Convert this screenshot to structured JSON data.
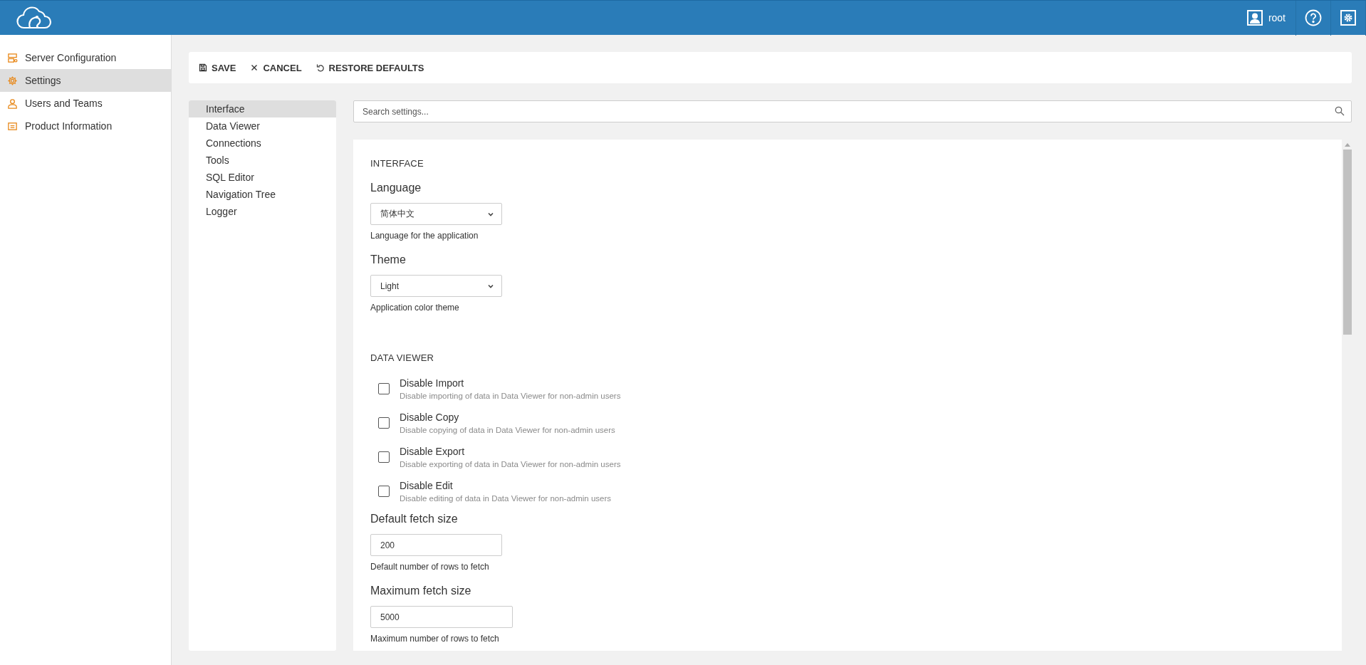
{
  "header": {
    "user": "root"
  },
  "sidebar": {
    "items": [
      {
        "label": "Server Configuration",
        "selected": false
      },
      {
        "label": "Settings",
        "selected": true
      },
      {
        "label": "Users and Teams",
        "selected": false
      },
      {
        "label": "Product Information",
        "selected": false
      }
    ]
  },
  "toolbar": {
    "buttons": [
      "SAVE",
      "CANCEL",
      "RESTORE DEFAULTS"
    ]
  },
  "settings_nav": {
    "items": [
      {
        "label": "Interface",
        "selected": true
      },
      {
        "label": "Data Viewer",
        "selected": false
      },
      {
        "label": "Connections",
        "selected": false
      },
      {
        "label": "Tools",
        "selected": false
      },
      {
        "label": "SQL Editor",
        "selected": false
      },
      {
        "label": "Navigation Tree",
        "selected": false
      },
      {
        "label": "Logger",
        "selected": false
      }
    ]
  },
  "search": {
    "placeholder": "Search settings..."
  },
  "sections": [
    {
      "title": "INTERFACE",
      "items": [
        {
          "kind": "select",
          "label": "Language",
          "value": "简体中文",
          "help": "Language for the application"
        },
        {
          "kind": "select",
          "label": "Theme",
          "value": "Light",
          "help": "Application color theme"
        }
      ]
    },
    {
      "title": "DATA VIEWER",
      "items": [
        {
          "kind": "checkbox",
          "label": "Disable Import",
          "description": "Disable importing of data in Data Viewer for non-admin users",
          "checked": false
        },
        {
          "kind": "checkbox",
          "label": "Disable Copy",
          "description": "Disable copying of data in Data Viewer for non-admin users",
          "checked": false
        },
        {
          "kind": "checkbox",
          "label": "Disable Export",
          "description": "Disable exporting of data in Data Viewer for non-admin users",
          "checked": false
        },
        {
          "kind": "checkbox",
          "label": "Disable Edit",
          "description": "Disable editing of data in Data Viewer for non-admin users",
          "checked": false
        },
        {
          "kind": "input",
          "label": "Default fetch size",
          "value": "200",
          "help": "Default number of rows to fetch"
        },
        {
          "kind": "input",
          "label": "Maximum fetch size",
          "value": "5000",
          "help": "Maximum number of rows to fetch",
          "wide": true
        }
      ]
    }
  ]
}
